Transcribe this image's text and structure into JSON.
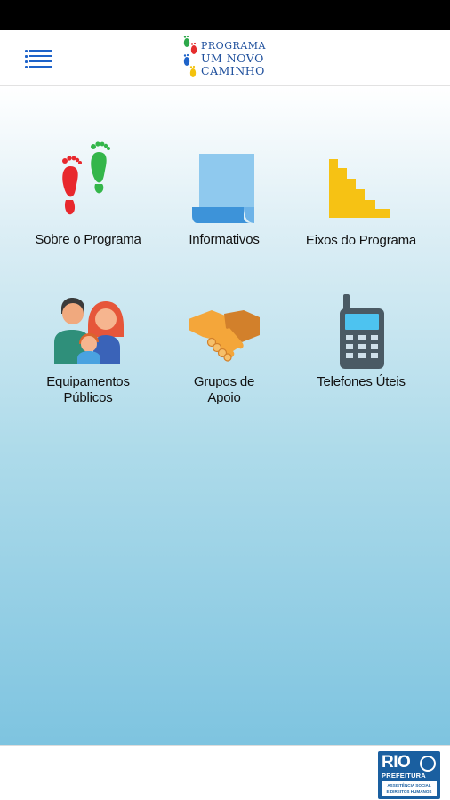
{
  "header": {
    "menu_icon": "menu-list-icon",
    "logo": {
      "line1": "PROGRAMA",
      "line2": "UM NOVO",
      "line3": "CAMINHO",
      "colors": [
        "#e52d2d",
        "#2da84a",
        "#1e63c9",
        "#f4c20d"
      ]
    }
  },
  "tiles": [
    {
      "label": "Sobre o Programa",
      "icon": "footprints-icon"
    },
    {
      "label": "Informativos",
      "icon": "scroll-icon"
    },
    {
      "label": "Eixos do Programa",
      "icon": "stairs-icon"
    },
    {
      "label_line1": "Equipamentos",
      "label_line2": "Públicos",
      "icon": "family-icon"
    },
    {
      "label_line1": "Grupos de",
      "label_line2": "Apoio",
      "icon": "handshake-icon"
    },
    {
      "label": "Telefones Úteis",
      "icon": "phone-icon"
    }
  ],
  "footer": {
    "badge_title": "RIO",
    "badge_subtitle": "PREFEITURA",
    "badge_dept_line1": "ASSISTÊNCIA SOCIAL",
    "badge_dept_line2": "E DIREITOS HUMANOS",
    "badge_color": "#1a5fa0"
  }
}
